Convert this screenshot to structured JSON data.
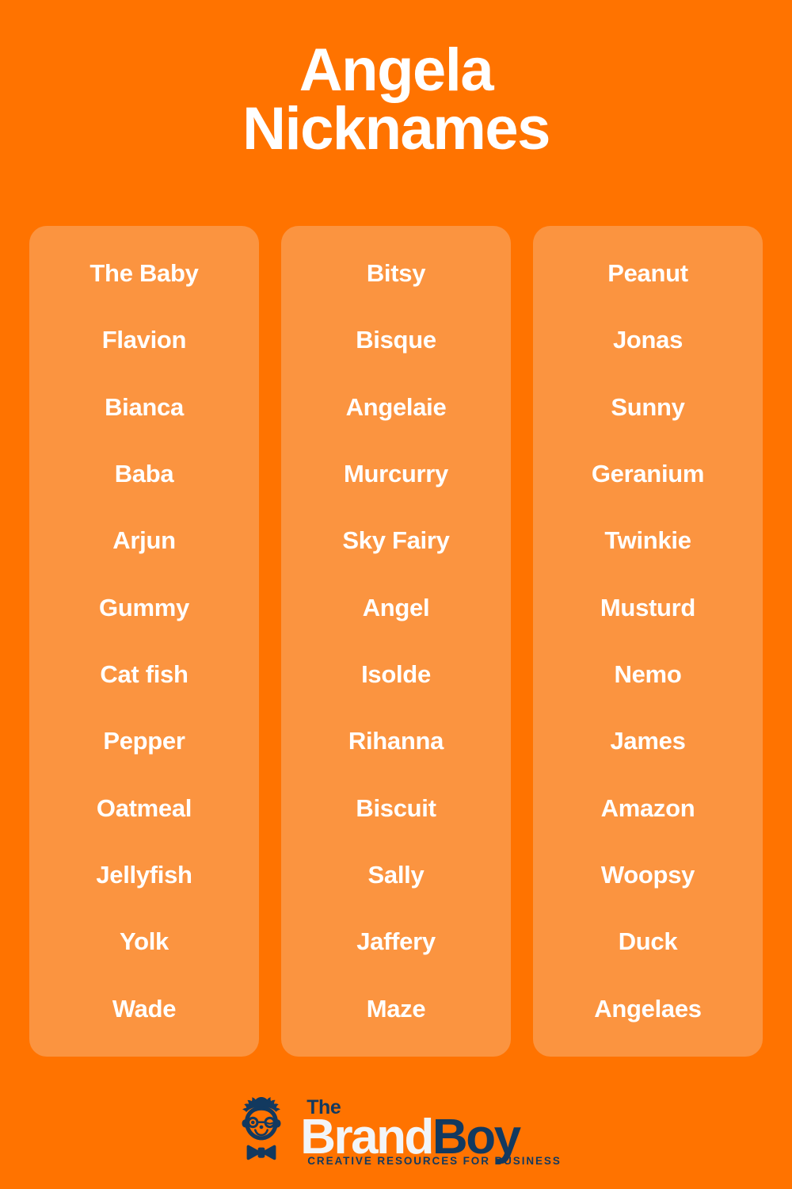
{
  "meta": {
    "background_color": "#FF7300",
    "card_color": "#FB9440",
    "text_color": "#FFFFFF",
    "logo_navy": "#12395F"
  },
  "header": {
    "title_line1": "Angela",
    "title_line2": "Nicknames"
  },
  "columns": [
    {
      "id": "column-1",
      "items": [
        "The Baby",
        "Flavion",
        "Bianca",
        "Baba",
        "Arjun",
        "Gummy",
        "Cat fish",
        "Pepper",
        "Oatmeal",
        "Jellyfish",
        "Yolk",
        "Wade"
      ]
    },
    {
      "id": "column-2",
      "items": [
        "Bitsy",
        "Bisque",
        "Angelaie",
        "Murcurry",
        "Sky Fairy",
        "Angel",
        "Isolde",
        "Rihanna",
        "Biscuit",
        "Sally",
        "Jaffery",
        "Maze"
      ]
    },
    {
      "id": "column-3",
      "items": [
        "Peanut",
        "Jonas",
        "Sunny",
        "Geranium",
        "Twinkie",
        "Musturd",
        "Nemo",
        "James",
        "Amazon",
        "Woopsy",
        "Duck",
        "Angelaes"
      ]
    }
  ],
  "footer": {
    "logo": {
      "the": "The",
      "brand": "Brand",
      "boy": "Boy",
      "tagline": "CREATIVE RESOURCES FOR BUSINESS"
    }
  }
}
